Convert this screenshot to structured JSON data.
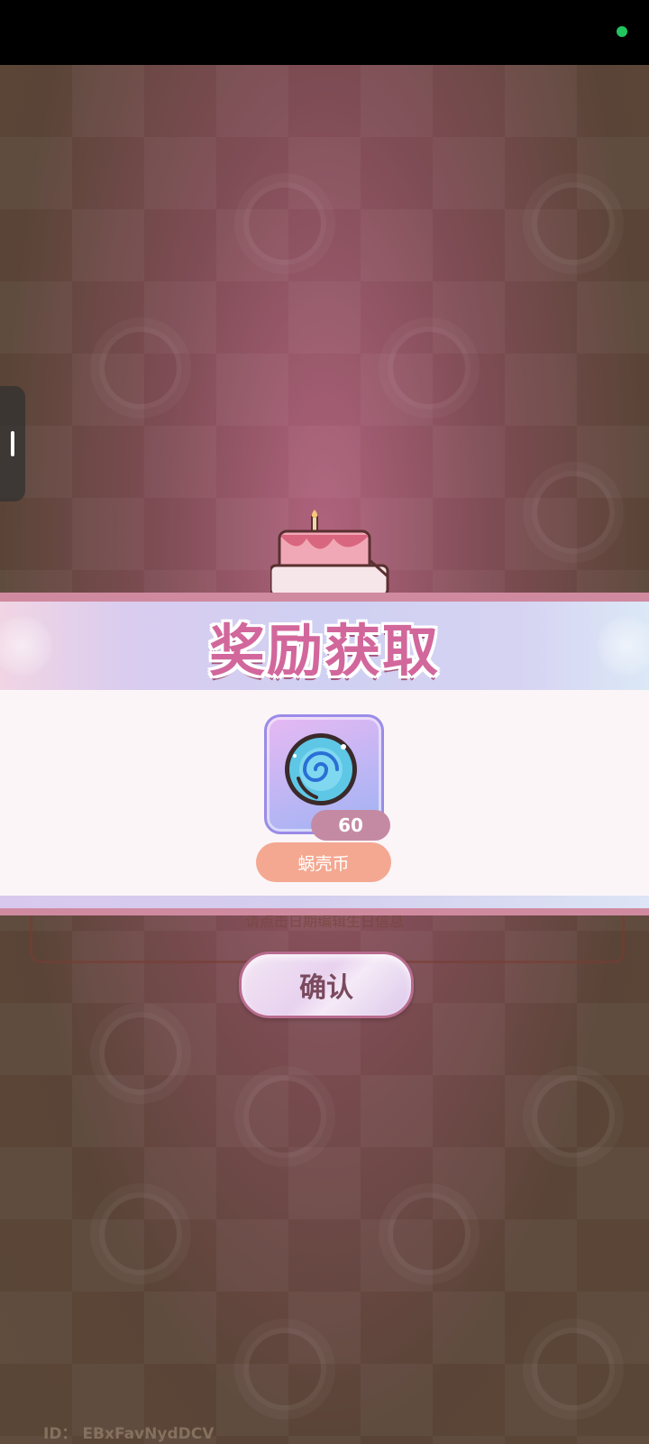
{
  "reward_dialog": {
    "title": "奖励获取",
    "item": {
      "name": "蜗壳币",
      "count": "60",
      "icon": "swirl-coin-icon"
    }
  },
  "birthday_panel": {
    "hint": "请点击日期编辑生日信息",
    "confirm_label": "确认"
  },
  "footer": {
    "id_label": "ID：",
    "id_value": "EBxFavNydDCV"
  },
  "colors": {
    "title_pink": "#d2679c",
    "border_pink": "#d08aa0",
    "item_name_bg": "#f4a891",
    "count_bg": "#c58aa3"
  }
}
